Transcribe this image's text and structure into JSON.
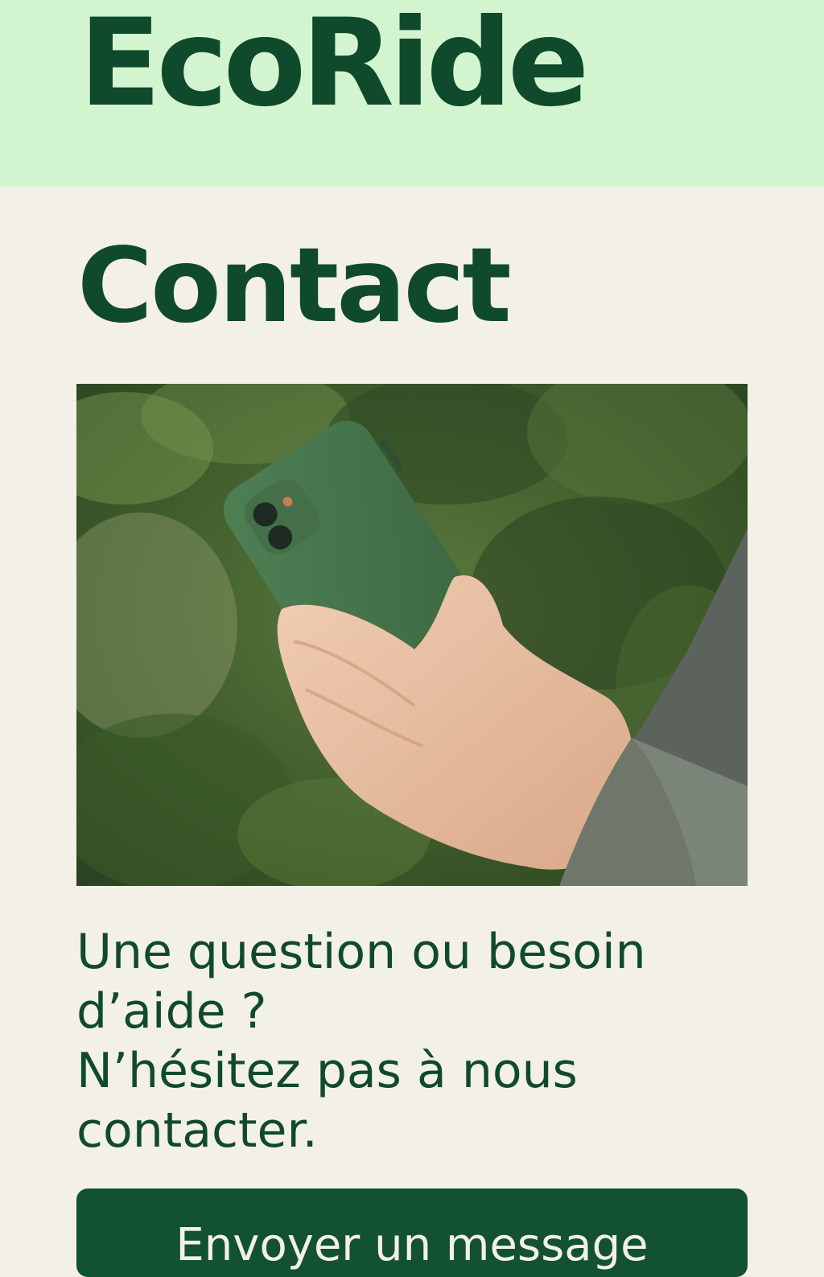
{
  "header": {
    "brand": "EcoRide"
  },
  "main": {
    "title": "Contact",
    "photo_icon": "hand-holding-phone-photo",
    "message_line1": "Une question ou besoin",
    "message_line2": "d’aide ?",
    "message_line3": "N’hésitez pas à nous",
    "message_line4": "contacter.",
    "cta_label": "Envoyer un message"
  },
  "colors": {
    "header_bg": "#d2f5cf",
    "page_bg": "#f3f0e8",
    "primary_text": "#104a2c",
    "button_bg": "#125232"
  }
}
